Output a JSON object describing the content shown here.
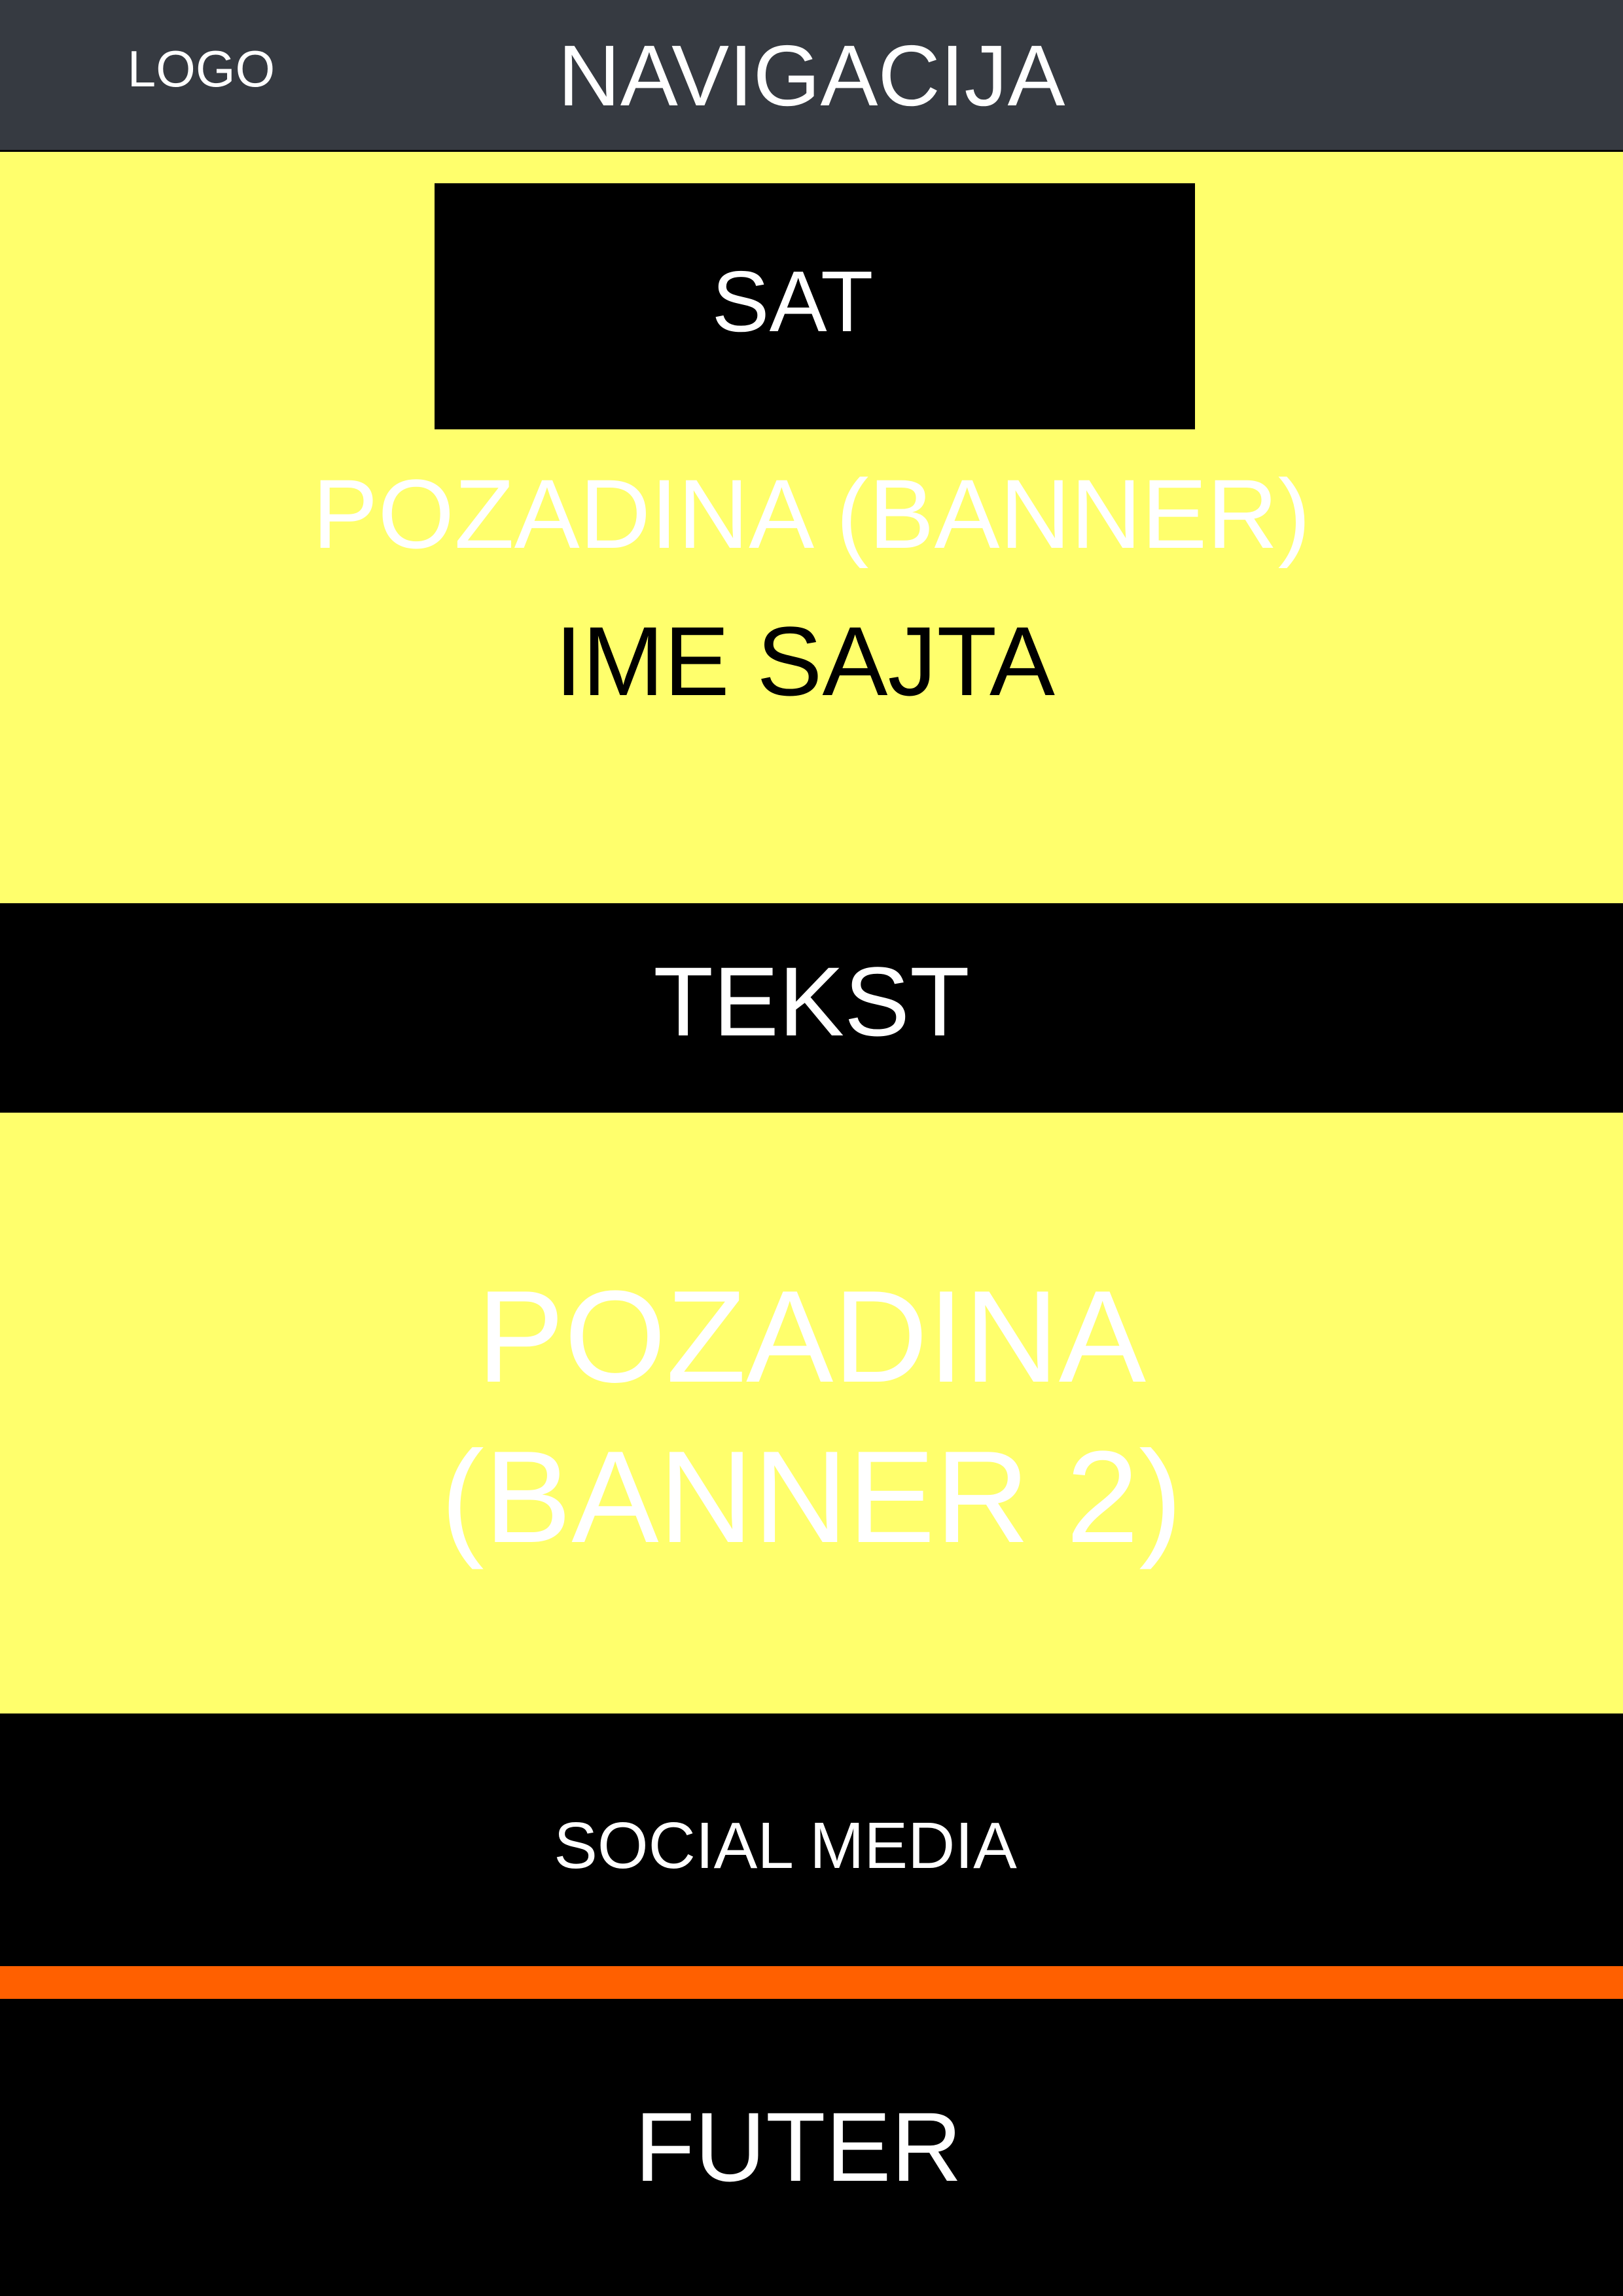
{
  "header": {
    "logo": "LOGO",
    "navigation": "NAVIGACIJA"
  },
  "hero": {
    "clock": "SAT",
    "banner_label": "POZADINA (BANNER)",
    "site_name": "IME SAJTA"
  },
  "text_section": {
    "label": "TEKST"
  },
  "banner2": {
    "line1": "POZADINA",
    "line2": "(BANNER 2)"
  },
  "social": {
    "label": "SOCIAL MEDIA"
  },
  "footer": {
    "label": "FUTER"
  },
  "colors": {
    "header_bg": "#363a41",
    "banner_bg": "#ffff6c",
    "block_bg": "#000000",
    "divider": "#ff6000",
    "text_light": "#ffffff",
    "text_dark": "#000000"
  }
}
